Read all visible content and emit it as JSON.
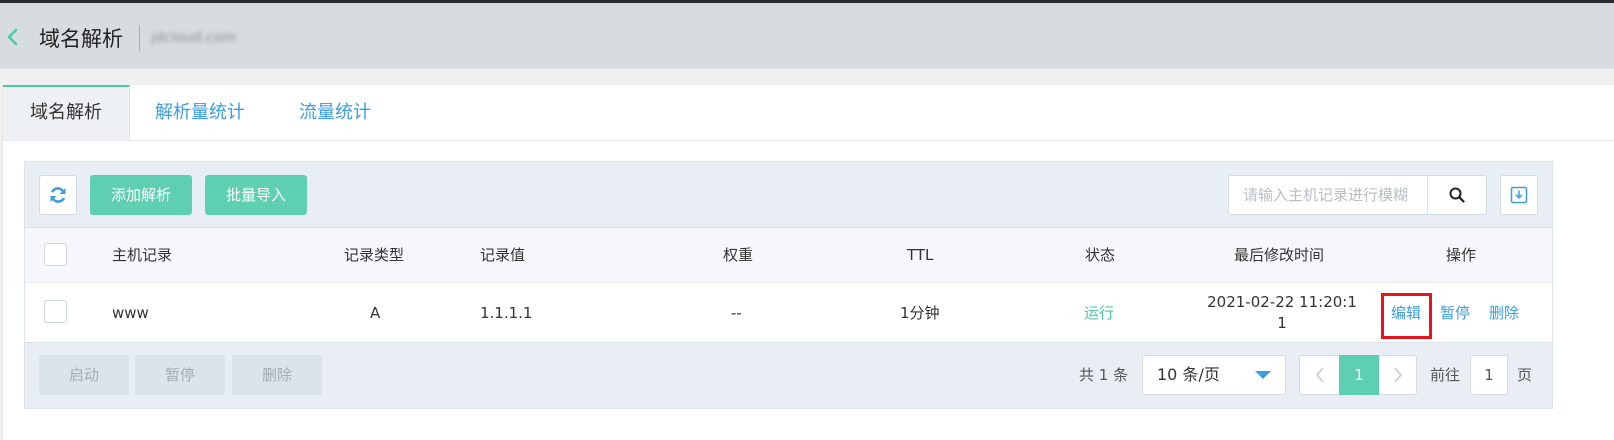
{
  "header": {
    "title": "域名解析",
    "domain": "jdcloud.com"
  },
  "tabs": [
    {
      "label": "域名解析",
      "active": true
    },
    {
      "label": "解析量统计",
      "active": false
    },
    {
      "label": "流量统计",
      "active": false
    }
  ],
  "toolbar": {
    "add_label": "添加解析",
    "import_label": "批量导入",
    "search_placeholder": "请输入主机记录进行模糊"
  },
  "table": {
    "columns": [
      "主机记录",
      "记录类型",
      "记录值",
      "权重",
      "TTL",
      "状态",
      "最后修改时间",
      "操作"
    ],
    "rows": [
      {
        "host": "www",
        "type": "A",
        "value": "1.1.1.1",
        "weight": "--",
        "ttl": "1分钟",
        "status": "运行",
        "modified_line1": "2021-02-22 11:20:1",
        "modified_line2": "1",
        "actions": {
          "edit": "编辑",
          "pause": "暂停",
          "delete": "删除"
        }
      }
    ]
  },
  "footer": {
    "batch_start": "启动",
    "batch_pause": "暂停",
    "batch_delete": "删除",
    "total": "共 1 条",
    "page_size": "10 条/页",
    "current_page": "1",
    "goto_prefix": "前往",
    "goto_value": "1",
    "goto_suffix": "页"
  },
  "colors": {
    "accent_green": "#5fcfb2",
    "link_blue": "#3c9de0",
    "highlight_red": "#e5161b"
  }
}
